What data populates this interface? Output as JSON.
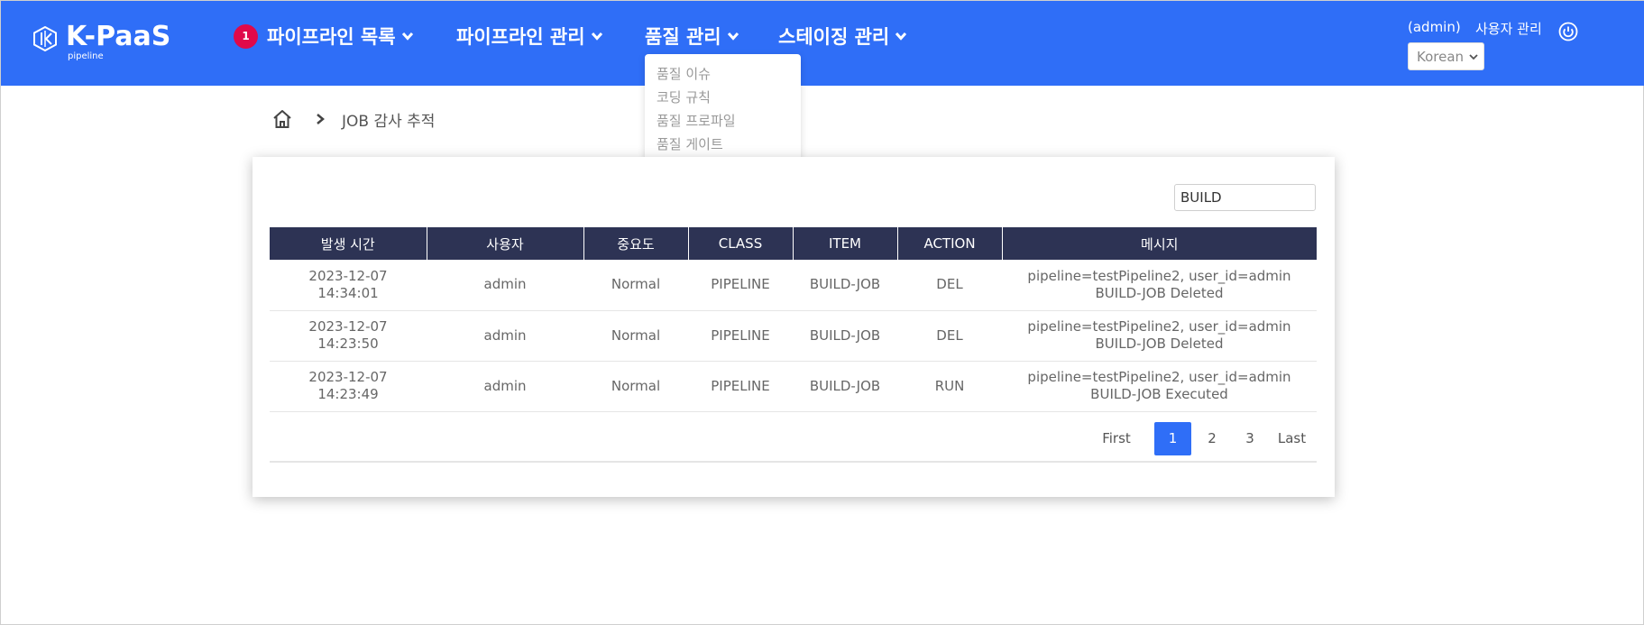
{
  "header": {
    "logo_text": "K-PaaS",
    "logo_sub": "pipeline",
    "nav": [
      {
        "label": "파이프라인 목록",
        "badge": "1"
      },
      {
        "label": "파이프라인 관리"
      },
      {
        "label": "품질 관리"
      },
      {
        "label": "스테이징 관리"
      }
    ],
    "user": "(admin)",
    "user_manage": "사용자 관리",
    "language": "Korean",
    "brand_color": "#2f6ef7"
  },
  "dropdown": {
    "items": [
      "품질 이슈",
      "코딩 규칙",
      "품질 프로파일",
      "품질 게이트"
    ]
  },
  "breadcrumb": {
    "current": "JOB 감사 추적"
  },
  "search": {
    "value": "BUILD"
  },
  "table": {
    "headers": [
      "발생 시간",
      "사용자",
      "중요도",
      "CLASS",
      "ITEM",
      "ACTION",
      "메시지"
    ],
    "rows": [
      [
        "2023-12-07 14:34:01",
        "admin",
        "Normal",
        "PIPELINE",
        "BUILD-JOB",
        "DEL",
        "pipeline=testPipeline2, user_id=admin BUILD-JOB Deleted"
      ],
      [
        "2023-12-07 14:23:50",
        "admin",
        "Normal",
        "PIPELINE",
        "BUILD-JOB",
        "DEL",
        "pipeline=testPipeline2, user_id=admin BUILD-JOB Deleted"
      ],
      [
        "2023-12-07 14:23:49",
        "admin",
        "Normal",
        "PIPELINE",
        "BUILD-JOB",
        "RUN",
        "pipeline=testPipeline2, user_id=admin BUILD-JOB Executed"
      ]
    ]
  },
  "pagination": {
    "first": "First",
    "pages": [
      "1",
      "2",
      "3"
    ],
    "active": "1",
    "last": "Last"
  }
}
